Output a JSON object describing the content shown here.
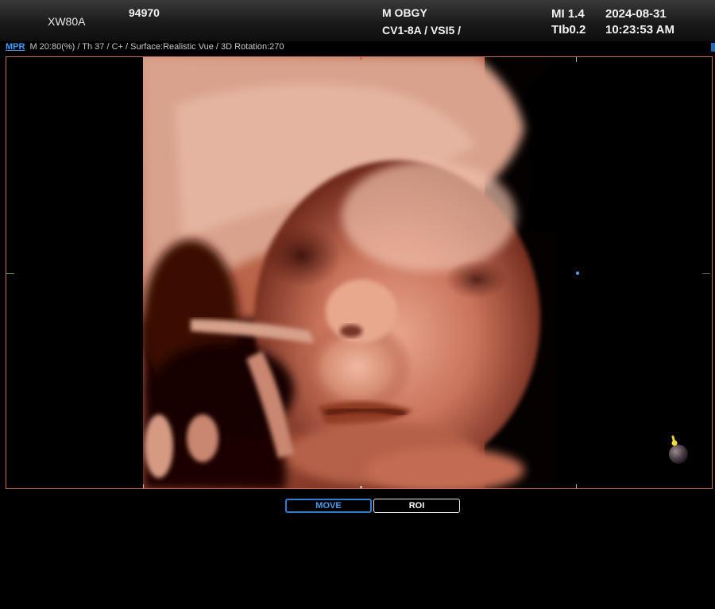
{
  "header": {
    "device_model": "XW80A",
    "patient_id": "94970",
    "preset": "M OBGY",
    "probe": "CV1-8A / VSI5 /",
    "mi": "MI  1.4",
    "tib": "TIb0.2",
    "date": "2024-08-31",
    "time": "10:23:53 AM"
  },
  "info_line": {
    "mode_link": "MPR",
    "parameters": "M 20:80(%) / Th 37 / C+ / Surface:Realistic Vue / 3D Rotation:270"
  },
  "viewport": {
    "render_description_icon": "fetal-face-3d-surface-render",
    "border_color": "#c8735a",
    "orientation_icon": "orientation-ball-icon"
  },
  "mode_buttons": {
    "move_label": "MOVE",
    "roi_label": "ROI",
    "active": "MOVE"
  },
  "colors": {
    "accent_blue": "#3ea0ff",
    "active_button_border": "#2f7fd0",
    "tissue_tone": "#d7907a"
  }
}
